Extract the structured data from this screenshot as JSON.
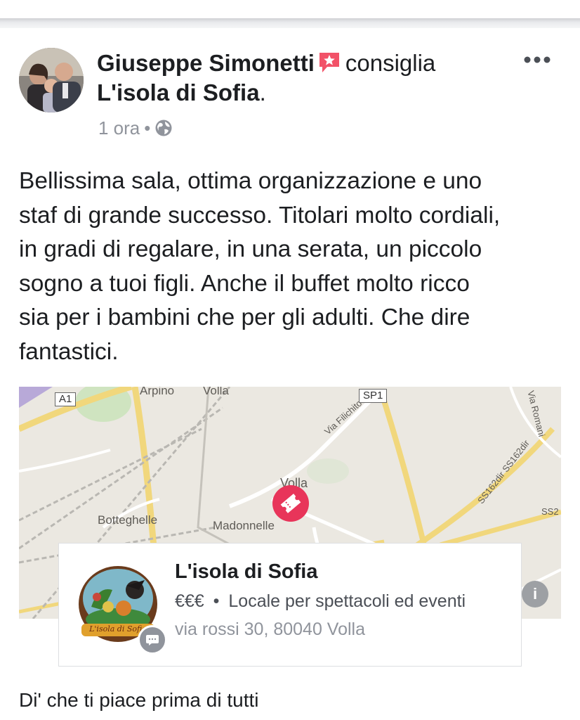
{
  "post": {
    "author": "Giuseppe Simonetti",
    "action": "consiglia",
    "page_name": "L'isola di Sofia",
    "page_name_suffix": ".",
    "time": "1 ora",
    "separator": "•",
    "privacy_icon": "globe-icon",
    "recommend_icon": "star-badge-icon",
    "more_icon": "more-options-icon",
    "text": "Bellissima sala, ottima organizzazione e uno\nstaf di grande successo. Titolari molto cordiali,\nin gradi di regalare, in una serata, un piccolo\nsogno a tuoi figli. Anche il  buffet molto ricco\nsia per i bambini che per gli adulti. Che dire\nfantastici."
  },
  "map": {
    "labels": {
      "arpino": "Arpino",
      "volla_top": "Volla",
      "volla": "Volla",
      "botteghelle": "Botteghelle",
      "madonnelle": "Madonnelle",
      "via_filichito": "Via Filichito",
      "via_romani": "Via Romani",
      "ss162": "SS162dir SS162dir",
      "ss2": "SS2"
    },
    "shields": {
      "a1": "A1",
      "sp1": "SP1"
    },
    "pin_icon": "ticket-icon",
    "info_label": "i"
  },
  "card": {
    "title": "L'isola di Sofia",
    "price": "€€€",
    "separator": "•",
    "category": "Locale per spettacoli ed eventi",
    "address": "via rossi 30, 80040 Volla",
    "logo_text": "L'isola di Sofia",
    "badge_icon": "message-icon"
  },
  "footer": {
    "like_prompt": "Di' che ti piace prima di tutti"
  },
  "colors": {
    "accent_pin": "#e8355a",
    "secondary_text": "#90949c",
    "badge_red": "#f25268"
  }
}
